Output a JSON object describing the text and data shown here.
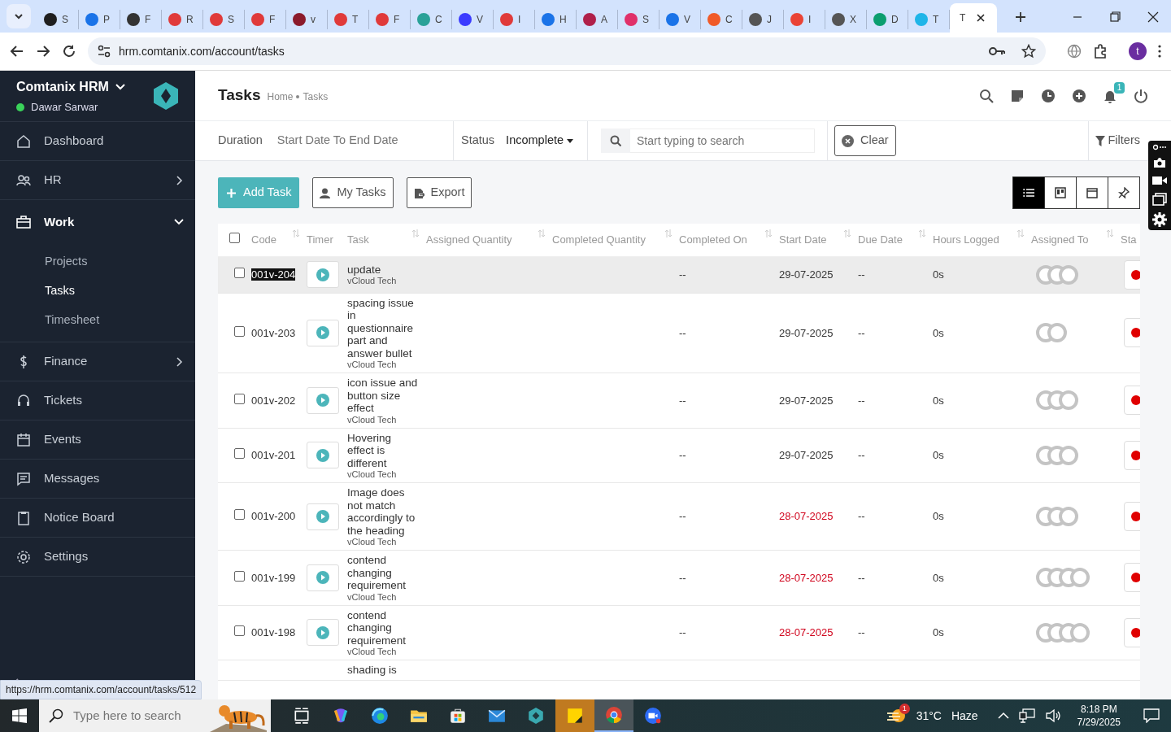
{
  "browser": {
    "tabs": [
      {
        "label": "S",
        "color": "#1f1f1f",
        "selected": false
      },
      {
        "label": "P",
        "color": "#1a73e8",
        "selected": false
      },
      {
        "label": "F",
        "color": "#333333",
        "selected": false
      },
      {
        "label": "R",
        "color": "#e03a3a",
        "selected": false
      },
      {
        "label": "S",
        "color": "#e03a3a",
        "selected": false
      },
      {
        "label": "F",
        "color": "#e03a3a",
        "selected": false
      },
      {
        "label": "v",
        "color": "#8b1a2b",
        "selected": false
      },
      {
        "label": "T",
        "color": "#e03a3a",
        "selected": false
      },
      {
        "label": "F",
        "color": "#e03a3a",
        "selected": false
      },
      {
        "label": "C",
        "color": "#2aa198",
        "selected": false
      },
      {
        "label": "V",
        "color": "#3b3bff",
        "selected": false
      },
      {
        "label": "I",
        "color": "#e03a3a",
        "selected": false
      },
      {
        "label": "H",
        "color": "#1a73e8",
        "selected": false
      },
      {
        "label": "A",
        "color": "#b0204a",
        "selected": false
      },
      {
        "label": "S",
        "color": "#e0306a",
        "selected": false
      },
      {
        "label": "V",
        "color": "#1a73e8",
        "selected": false
      },
      {
        "label": "C",
        "color": "#f05a28",
        "selected": false
      },
      {
        "label": "J",
        "color": "#555555",
        "selected": false
      },
      {
        "label": "I",
        "color": "#ea4335",
        "selected": false
      },
      {
        "label": "X",
        "color": "#555555",
        "selected": false
      },
      {
        "label": "D",
        "color": "#0b9e6f",
        "selected": false
      },
      {
        "label": "T",
        "color": "#1fb5e8",
        "selected": false
      },
      {
        "label": "T",
        "selected": true
      }
    ],
    "url": "hrm.comtanix.com/account/tasks",
    "profile": "t",
    "status_url": "https://hrm.comtanix.com/account/tasks/512"
  },
  "sidebar": {
    "brand": "Comtanix HRM",
    "user": "Dawar Sarwar",
    "online": true,
    "items": [
      {
        "label": "Dashboard",
        "kind": "link",
        "selected": false
      },
      {
        "label": "HR",
        "kind": "group",
        "selected": false,
        "expanded": false
      },
      {
        "label": "Work",
        "kind": "group",
        "selected": true,
        "expanded": true,
        "children": [
          {
            "label": "Projects",
            "selected": false
          },
          {
            "label": "Tasks",
            "selected": true
          },
          {
            "label": "Timesheet",
            "selected": false
          }
        ]
      },
      {
        "label": "Finance",
        "kind": "group",
        "selected": false,
        "expanded": false
      },
      {
        "label": "Tickets",
        "kind": "link",
        "selected": false
      },
      {
        "label": "Events",
        "kind": "link",
        "selected": false
      },
      {
        "label": "Messages",
        "kind": "link",
        "selected": false
      },
      {
        "label": "Notice Board",
        "kind": "link",
        "selected": false
      },
      {
        "label": "Settings",
        "kind": "link",
        "selected": false
      }
    ]
  },
  "header": {
    "title": "Tasks",
    "breadcrumb": [
      "Home",
      "Tasks"
    ],
    "notifications": "1"
  },
  "filters": {
    "duration_label": "Duration",
    "date_placeholder": "Start Date To End Date",
    "status_label": "Status",
    "status_value": "Incomplete",
    "search_placeholder": "Start typing to search",
    "clear": "Clear",
    "filters": "Filters"
  },
  "actions": [
    {
      "label": "Add Task",
      "kind": "primary"
    },
    {
      "label": "My Tasks",
      "kind": "person"
    },
    {
      "label": "Export",
      "kind": "export"
    }
  ],
  "views": [
    {
      "kind": "list",
      "selected": true
    },
    {
      "kind": "board",
      "selected": false
    },
    {
      "kind": "calendar",
      "selected": false
    },
    {
      "kind": "pin",
      "selected": false
    }
  ],
  "table": {
    "all_checked": false,
    "columns": [
      {
        "label": "Code",
        "sortable": true
      },
      {
        "label": "Timer",
        "sortable": false
      },
      {
        "label": "Task",
        "sortable": true
      },
      {
        "label": "Assigned Quantity",
        "sortable": true
      },
      {
        "label": "Completed Quantity",
        "sortable": true
      },
      {
        "label": "Completed On",
        "sortable": true
      },
      {
        "label": "Start Date",
        "sortable": true
      },
      {
        "label": "Due Date",
        "sortable": true
      },
      {
        "label": "Hours Logged",
        "sortable": true
      },
      {
        "label": "Assigned To",
        "sortable": true
      },
      {
        "label": "Sta",
        "sortable": false
      }
    ],
    "rows": [
      {
        "selected": true,
        "checked": false,
        "code": "001v-204",
        "code_highlighted": true,
        "task": "update",
        "project": "vCloud Tech",
        "completed_on": "--",
        "start_date": "29-07-2025",
        "overdue": false,
        "due_date": "--",
        "hours_logged": "0s",
        "assignees": [
          {
            "kind": "avatar"
          },
          {
            "kind": "avatar"
          },
          {
            "kind": "avatar"
          }
        ],
        "status": {
          "color": "#e00000"
        }
      },
      {
        "selected": false,
        "checked": false,
        "code": "001v-203",
        "code_highlighted": false,
        "task": "spacing issue in questionnaire part and answer bullet",
        "project": "vCloud Tech",
        "completed_on": "--",
        "start_date": "29-07-2025",
        "overdue": false,
        "due_date": "--",
        "hours_logged": "0s",
        "assignees": [
          {
            "kind": "avatar"
          },
          {
            "kind": "avatar"
          }
        ],
        "status": {
          "color": "#e00000"
        }
      },
      {
        "selected": false,
        "checked": false,
        "code": "001v-202",
        "code_highlighted": false,
        "task": "icon issue and button size effect",
        "project": "vCloud Tech",
        "completed_on": "--",
        "start_date": "29-07-2025",
        "overdue": false,
        "due_date": "--",
        "hours_logged": "0s",
        "assignees": [
          {
            "kind": "avatar"
          },
          {
            "kind": "avatar"
          },
          {
            "kind": "avatar"
          }
        ],
        "status": {
          "color": "#e00000"
        }
      },
      {
        "selected": false,
        "checked": false,
        "code": "001v-201",
        "code_highlighted": false,
        "task": "Hovering effect is different",
        "project": "vCloud Tech",
        "completed_on": "--",
        "start_date": "29-07-2025",
        "overdue": false,
        "due_date": "--",
        "hours_logged": "0s",
        "assignees": [
          {
            "kind": "avatar"
          },
          {
            "kind": "avatar"
          },
          {
            "kind": "avatar"
          }
        ],
        "status": {
          "color": "#e00000"
        }
      },
      {
        "selected": false,
        "checked": false,
        "code": "001v-200",
        "code_highlighted": false,
        "task": "Image does not match accordingly to the heading",
        "project": "vCloud Tech",
        "completed_on": "--",
        "start_date": "28-07-2025",
        "overdue": true,
        "due_date": "--",
        "hours_logged": "0s",
        "assignees": [
          {
            "kind": "avatar"
          },
          {
            "kind": "avatar"
          },
          {
            "kind": "avatar"
          }
        ],
        "status": {
          "color": "#e00000"
        }
      },
      {
        "selected": false,
        "checked": false,
        "code": "001v-199",
        "code_highlighted": false,
        "task": "contend changing requirement",
        "project": "vCloud Tech",
        "completed_on": "--",
        "start_date": "28-07-2025",
        "overdue": true,
        "due_date": "--",
        "hours_logged": "0s",
        "assignees": [
          {
            "kind": "avatar"
          },
          {
            "kind": "avatar"
          },
          {
            "kind": "avatar"
          },
          {
            "kind": "avatar"
          }
        ],
        "status": {
          "color": "#e00000"
        }
      },
      {
        "selected": false,
        "checked": false,
        "code": "001v-198",
        "code_highlighted": false,
        "task": "contend changing requirement",
        "project": "vCloud Tech",
        "completed_on": "--",
        "start_date": "28-07-2025",
        "overdue": true,
        "due_date": "--",
        "hours_logged": "0s",
        "assignees": [
          {
            "kind": "avatar"
          },
          {
            "kind": "avatar"
          },
          {
            "kind": "avatar"
          },
          {
            "kind": "avatar"
          }
        ],
        "status": {
          "color": "#e00000"
        }
      },
      {
        "selected": false,
        "task": "shading is"
      }
    ]
  },
  "taskbar": {
    "search_placeholder": "Type here to search",
    "apps": [
      {
        "kind": "taskview",
        "active": false,
        "flashing": false
      },
      {
        "kind": "copilot",
        "active": false,
        "flashing": false
      },
      {
        "kind": "edge",
        "active": false,
        "flashing": false
      },
      {
        "kind": "explorer",
        "active": false,
        "flashing": false
      },
      {
        "kind": "store",
        "active": false,
        "flashing": false
      },
      {
        "kind": "mail",
        "active": false,
        "flashing": false
      },
      {
        "kind": "hexapp",
        "active": false,
        "flashing": false
      },
      {
        "kind": "sticky",
        "active": false,
        "flashing": true
      },
      {
        "kind": "chrome",
        "active": true,
        "flashing": false
      },
      {
        "kind": "zoom",
        "active": false,
        "flashing": false
      }
    ],
    "weather_badge": "1",
    "temperature": "31°C",
    "condition": "Haze",
    "time": "8:18 PM",
    "date": "7/29/2025"
  }
}
